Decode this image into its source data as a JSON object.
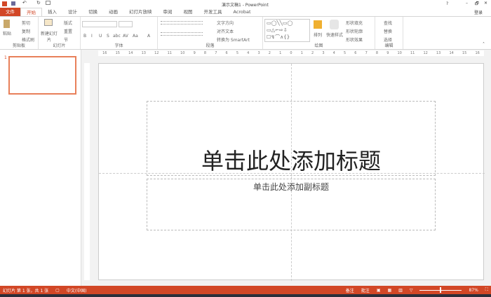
{
  "window": {
    "title": "演示文稿1 - PowerPoint",
    "help": "?",
    "minimize": "–",
    "maximize": "🗗",
    "close": "✕",
    "login": "登录"
  },
  "tabs": [
    "文件",
    "开始",
    "插入",
    "设计",
    "切换",
    "动画",
    "幻灯片放映",
    "审阅",
    "视图",
    "开发工具",
    "Acrobat"
  ],
  "ribbon": {
    "clipboard": {
      "label": "剪贴板",
      "paste": "粘贴",
      "cut": "剪切",
      "copy": "复制",
      "format_painter": "格式刷"
    },
    "slides": {
      "label": "幻灯片",
      "new_slide": "新建幻灯片",
      "layout": "版式",
      "reset": "重置",
      "section": "节"
    },
    "font": {
      "label": "字体",
      "bold": "B",
      "italic": "I",
      "underline": "U",
      "shadow": "S",
      "strike": "abc",
      "spacing": "AV",
      "case": "Aa",
      "color": "A"
    },
    "paragraph": {
      "label": "段落",
      "text_direction": "文字方向",
      "align_text": "对齐文本",
      "smartart": "转换为 SmartArt"
    },
    "drawing": {
      "label": "绘图",
      "arrange": "排列",
      "quick_styles": "快速样式",
      "shape_fill": "形状填充",
      "shape_outline": "形状轮廓",
      "shape_effects": "形状效果"
    },
    "editing": {
      "label": "编辑",
      "find": "查找",
      "replace": "替换",
      "select": "选择"
    }
  },
  "ruler": [
    "16",
    "15",
    "14",
    "13",
    "12",
    "11",
    "10",
    "9",
    "8",
    "7",
    "6",
    "5",
    "4",
    "3",
    "2",
    "1",
    "0",
    "1",
    "2",
    "3",
    "4",
    "5",
    "6",
    "7",
    "8",
    "9",
    "10",
    "11",
    "12",
    "13",
    "14",
    "15",
    "16"
  ],
  "thumbnail_number": "1",
  "slide": {
    "title_placeholder": "单击此处添加标题",
    "subtitle_placeholder": "单击此处添加副标题"
  },
  "status": {
    "slide_info": "幻灯片 第 1 张，共 1 张",
    "language": "中文(中国)",
    "notes": "备注",
    "comments": "批注",
    "zoom": "87%",
    "zoom_fraction": 0.5
  }
}
